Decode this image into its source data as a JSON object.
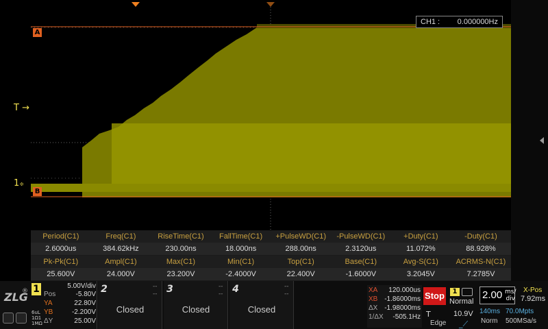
{
  "markers": {
    "trigger_level": "T",
    "ch1_ground": "1",
    "cursor_a": "A",
    "cursor_b": "B"
  },
  "frequency_counter": {
    "label": "CH1 :",
    "value": "0.000000Hz"
  },
  "measurements": {
    "row1": [
      {
        "label": "Period(C1)",
        "value": "2.6000us"
      },
      {
        "label": "Freq(C1)",
        "value": "384.62kHz"
      },
      {
        "label": "RiseTime(C1)",
        "value": "230.00ns"
      },
      {
        "label": "FallTime(C1)",
        "value": "18.000ns"
      },
      {
        "label": "+PulseWD(C1)",
        "value": "288.00ns"
      },
      {
        "label": "-PulseWD(C1)",
        "value": "2.3120us"
      },
      {
        "label": "+Duty(C1)",
        "value": "11.072%"
      },
      {
        "label": "-Duty(C1)",
        "value": "88.928%"
      }
    ],
    "row2": [
      {
        "label": "Pk-Pk(C1)",
        "value": "25.600V"
      },
      {
        "label": "Ampl(C1)",
        "value": "24.000V"
      },
      {
        "label": "Max(C1)",
        "value": "23.200V"
      },
      {
        "label": "Min(C1)",
        "value": "-2.4000V"
      },
      {
        "label": "Top(C1)",
        "value": "22.400V"
      },
      {
        "label": "Base(C1)",
        "value": "-1.6000V"
      },
      {
        "label": "Avg-S(C1)",
        "value": "3.2045V"
      },
      {
        "label": "ACRMS-N(C1)",
        "value": "7.2785V"
      }
    ]
  },
  "logo": {
    "text": "ZLG",
    "reg": "®"
  },
  "ch1": {
    "number": "1",
    "vdiv": "5.00V/div",
    "pos_label": "Pos",
    "pos_value": "-5.80V",
    "ya_label": "YA",
    "ya_value": "22.80V",
    "yb_label": "YB",
    "yb_value": "-2.200V",
    "dy_label": "ΔY",
    "dy_value": "25.00V",
    "side": [
      "6uL",
      "1Ω1",
      "1MΩ"
    ]
  },
  "channels": [
    {
      "number": "2",
      "status": "Closed",
      "dash": "--"
    },
    {
      "number": "3",
      "status": "Closed",
      "dash": "--"
    },
    {
      "number": "4",
      "status": "Closed",
      "dash": "--"
    }
  ],
  "cursors": {
    "xa_label": "XA",
    "xa_value": "120.000us",
    "xb_label": "XB",
    "xb_value": "-1.86000ms",
    "dx_label": "ΔX",
    "dx_value": "-1.98000ms",
    "inv_label": "1/ΔX",
    "inv_value": "-505.1Hz"
  },
  "trigger": {
    "run_state": "Stop",
    "channel": "1",
    "mode": "Normal",
    "t_label": "T",
    "level": "10.9V",
    "type": "Edge"
  },
  "timebase": {
    "value": "2.00",
    "unit_top": "ms/",
    "unit_bottom": "div",
    "xpos_label": "X-Pos",
    "xpos_value": "7.92ms",
    "memory_depth": "140ms",
    "sample_points": "70.0Mpts",
    "acq_mode": "Norm",
    "sample_rate": "500MSa/s"
  },
  "colors": {
    "ch1": "#f0e050",
    "cursor": "#e06020",
    "trace": "#9a9a00"
  }
}
